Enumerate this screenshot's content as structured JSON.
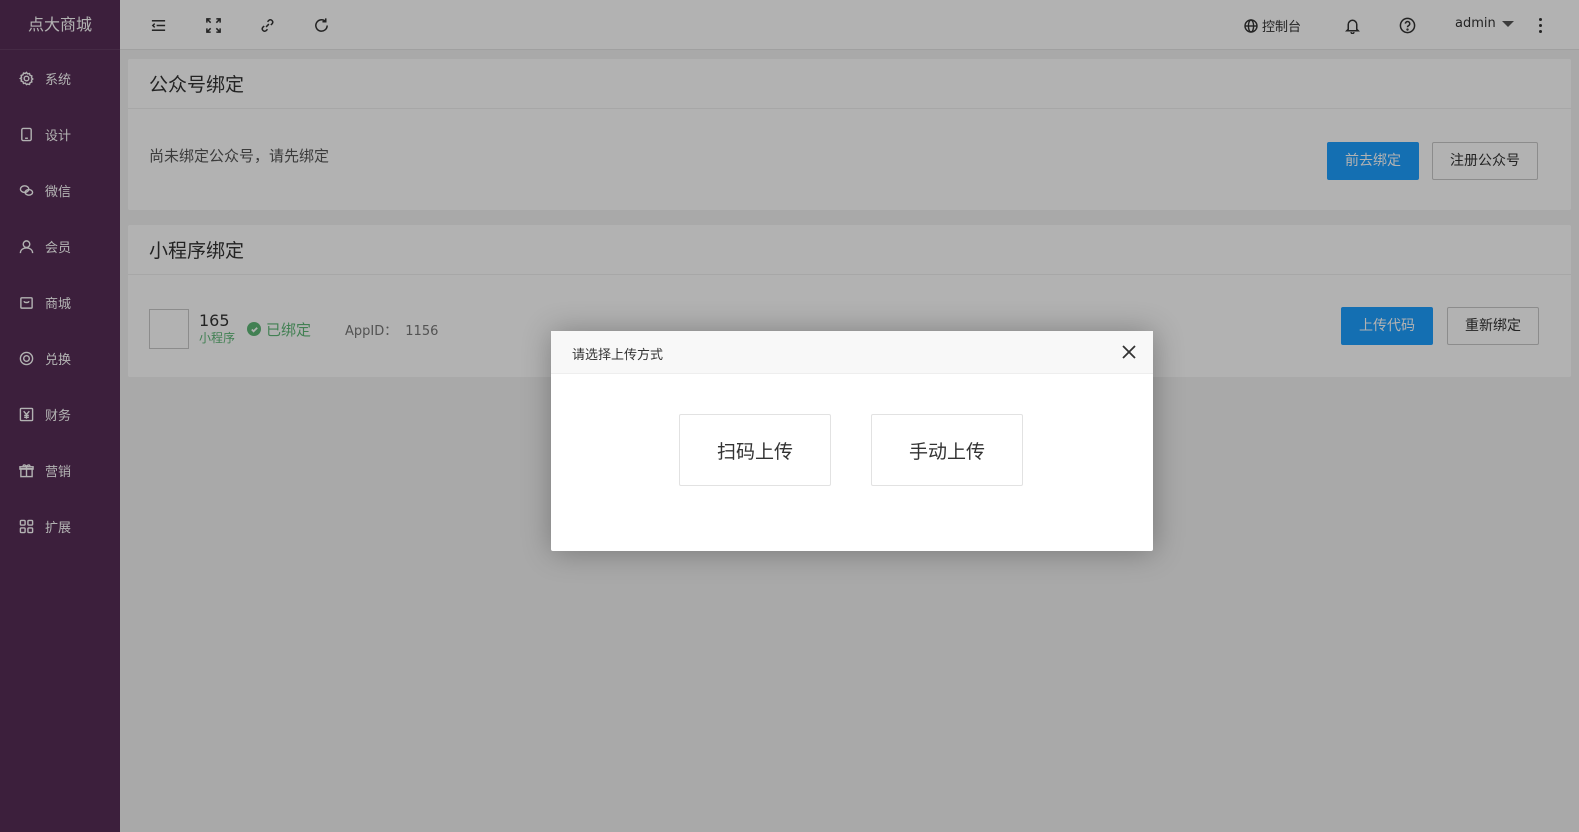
{
  "sidebar": {
    "logo": "点大商城",
    "items": [
      {
        "label": "系统",
        "icon": "gear-icon"
      },
      {
        "label": "设计",
        "icon": "tablet-icon"
      },
      {
        "label": "微信",
        "icon": "wechat-icon"
      },
      {
        "label": "会员",
        "icon": "user-icon"
      },
      {
        "label": "商城",
        "icon": "bag-icon"
      },
      {
        "label": "兑换",
        "icon": "coin-icon"
      },
      {
        "label": "财务",
        "icon": "yen-icon"
      },
      {
        "label": "营销",
        "icon": "gift-icon"
      },
      {
        "label": "扩展",
        "icon": "grid-icon"
      }
    ]
  },
  "header": {
    "console": "控制台",
    "user": "admin"
  },
  "wechat_card": {
    "title": "公众号绑定",
    "status_text": "尚未绑定公众号，请先绑定",
    "bind_button": "前去绑定",
    "register_button": "注册公众号"
  },
  "mini_card": {
    "title": "小程序绑定",
    "name": "165",
    "type": "小程序",
    "status": "已绑定",
    "appid_label": "AppID：",
    "appid_value": "1156",
    "upload_button": "上传代码",
    "rebind_button": "重新绑定"
  },
  "dialog": {
    "title": "请选择上传方式",
    "scan_button": "扫码上传",
    "manual_button": "手动上传"
  },
  "colors": {
    "sidebar": "#562d56",
    "primary": "#1e9fff",
    "success": "#5fb878"
  }
}
